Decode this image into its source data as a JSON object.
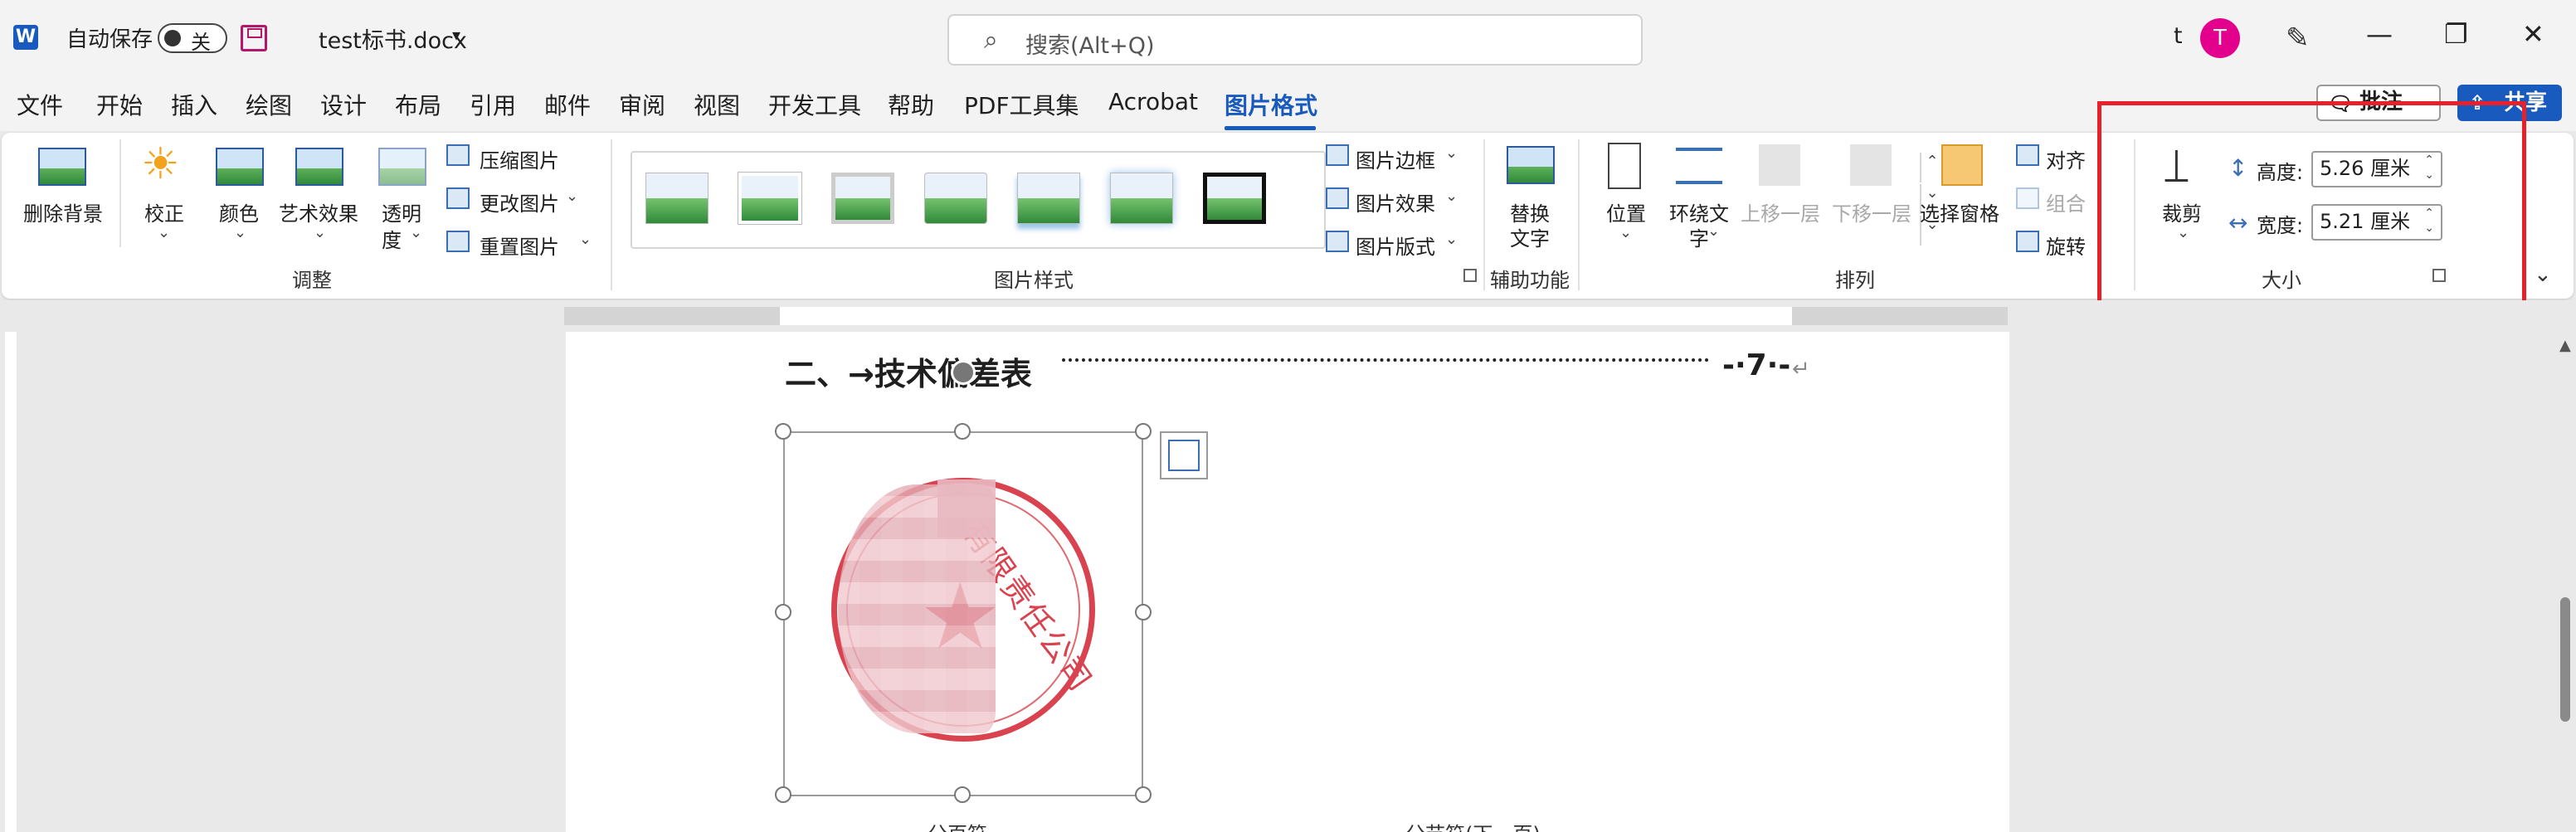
{
  "titlebar": {
    "app_icon": "W",
    "autosave_label": "自动保存",
    "autosave_state": "关",
    "doc_name": "test标书.docx",
    "search_placeholder": "搜索(Alt+Q)",
    "user_letter": "t",
    "avatar_letter": "T"
  },
  "menu": {
    "tabs": [
      "文件",
      "开始",
      "插入",
      "绘图",
      "设计",
      "布局",
      "引用",
      "邮件",
      "审阅",
      "视图",
      "开发工具",
      "帮助",
      "PDF工具集",
      "Acrobat",
      "图片格式"
    ],
    "active_tab": "图片格式",
    "comment_label": "批注",
    "share_label": "共享"
  },
  "ribbon": {
    "adjust": {
      "remove_bg": "删除背景",
      "corrections": "校正",
      "color": "颜色",
      "artistic": "艺术效果",
      "transparency_1": "透明",
      "transparency_2": "度",
      "compress": "压缩图片",
      "change": "更改图片",
      "reset": "重置图片",
      "group_label": "调整"
    },
    "styles": {
      "border": "图片边框",
      "effects": "图片效果",
      "layout": "图片版式",
      "group_label": "图片样式"
    },
    "accessibility": {
      "alt_text_1": "替换",
      "alt_text_2": "文字",
      "group_label": "辅助功能"
    },
    "arrange": {
      "position": "位置",
      "wrap_1": "环绕文",
      "wrap_2": "字",
      "forward": "上移一层",
      "backward": "下移一层",
      "selection_pane": "选择窗格",
      "align": "对齐",
      "group": "组合",
      "rotate": "旋转",
      "group_label": "排列"
    },
    "size": {
      "crop": "裁剪",
      "height_label": "高度:",
      "height_value": "5.26 厘米",
      "width_label": "宽度:",
      "width_value": "5.21 厘米",
      "group_label": "大小"
    }
  },
  "document": {
    "heading": "二、→技术偏差表",
    "page_ref": "-·7·-",
    "seal_text": "有限责任公司",
    "bottom_left": "分页符",
    "bottom_right": "分节符(下一页)"
  },
  "colors": {
    "accent": "#185abd",
    "avatar": "#e3008c",
    "highlight_box": "#e8202a",
    "seal_red": "#d9434f"
  }
}
